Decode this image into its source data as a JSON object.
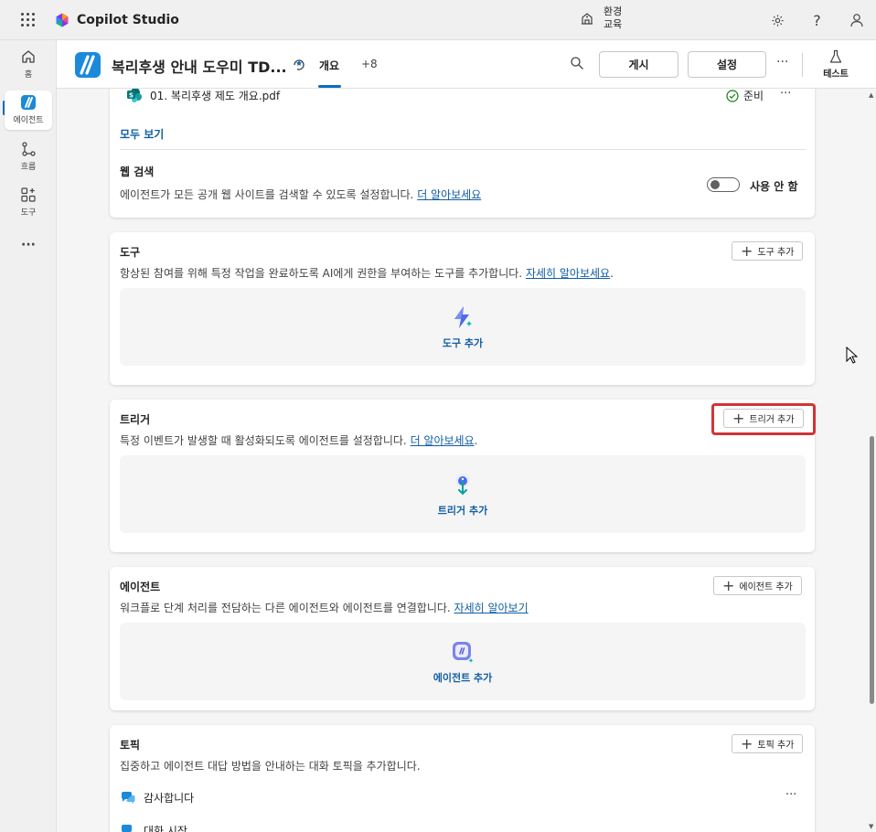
{
  "topbar": {
    "app_name": "Copilot Studio",
    "env_label": "환경",
    "env_value": "교육"
  },
  "rail": {
    "items": [
      {
        "label": "홈"
      },
      {
        "label": "에이전트"
      },
      {
        "label": "흐름"
      },
      {
        "label": "도구"
      }
    ],
    "more": "···"
  },
  "header": {
    "agent_name": "복리후생 안내 도우미 TD...",
    "tab_overview": "개요",
    "tab_more": "+8",
    "publish_label": "게시",
    "settings_label": "설정",
    "more": "···",
    "test_label": "테스트"
  },
  "knowledge": {
    "file_name": "01. 복리후생 제도 개요.pdf",
    "file_status": "준비",
    "row_more": "···",
    "see_all": "모두 보기",
    "web_search_title": "웹 검색",
    "web_search_desc": "에이전트가 모든 공개 웹 사이트를 검색할 수 있도록 설정합니다.",
    "web_search_link": "더 알아보세요",
    "toggle_label": "사용 안 함"
  },
  "tools": {
    "title": "도구",
    "desc": "항상된 참여를 위해 특정 작업을 완료하도록 AI에게 권한을 부여하는 도구를 추가합니다.",
    "link": "자세히 알아보세요",
    "period": ".",
    "add_button": "도구 추가",
    "empty_label": "도구 추가"
  },
  "triggers": {
    "title": "트리거",
    "desc": "특정 이벤트가 발생할 때 활성화되도록 에이전트를 설정합니다.",
    "link": "더 알아보세요",
    "period": ".",
    "add_button": "트리거 추가",
    "empty_label": "트리거 추가"
  },
  "agents": {
    "title": "에이전트",
    "desc": "워크플로 단계 처리를 전담하는 다른 에이전트와 에이전트를 연결합니다.",
    "link": "자세히 알아보기",
    "add_button": "에이전트 추가",
    "empty_label": "에이전트 추가"
  },
  "topics": {
    "title": "토픽",
    "desc": "집중하고 에이전트 대답 방법을 안내하는 대화 토픽을 추가합니다.",
    "add_button": "토픽 추가",
    "items": [
      {
        "label": "감사합니다",
        "more": "···"
      },
      {
        "label": "대화 시작"
      }
    ]
  },
  "colors": {
    "accent": "#0f6cbd",
    "link": "#115ea3",
    "highlight": "#d13438"
  }
}
